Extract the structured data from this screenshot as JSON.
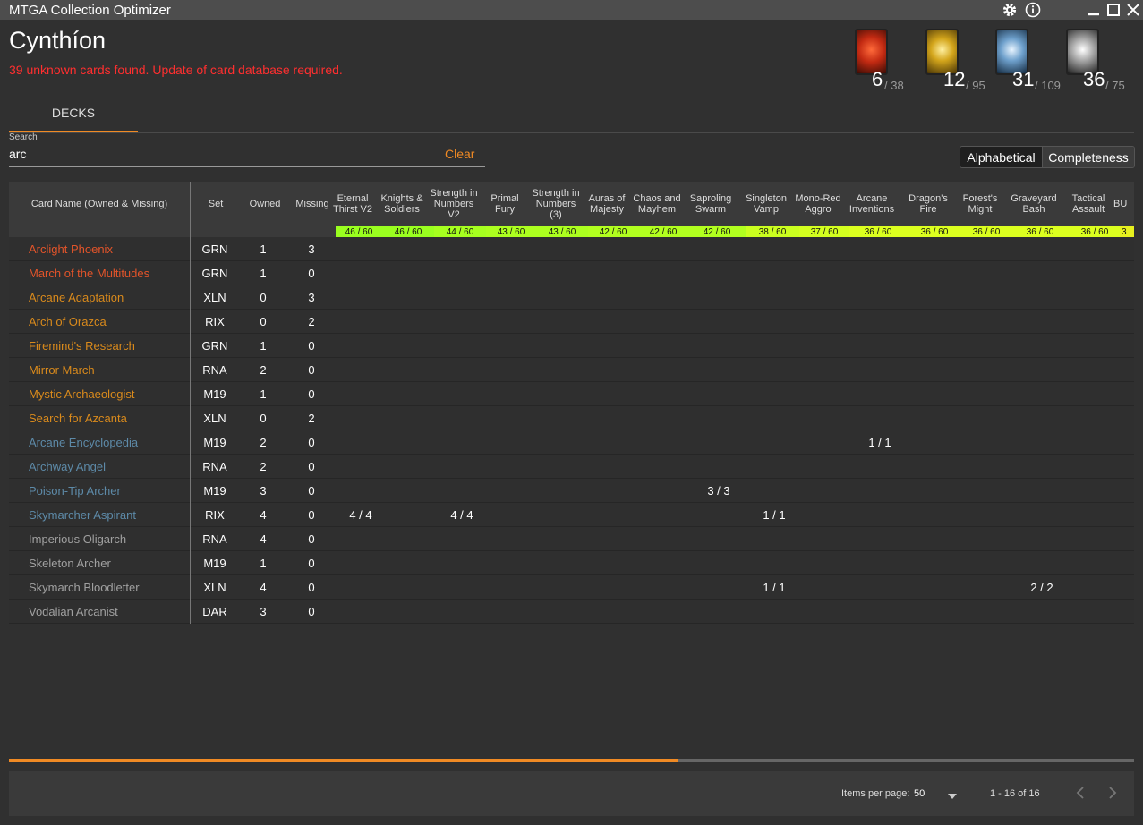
{
  "app": {
    "title": "MTGA Collection Optimizer"
  },
  "profile": {
    "name": "Cynthíon",
    "warning": "39 unknown cards found. Update of card database required."
  },
  "mana_counts": [
    {
      "icon": "red-mana-card-icon",
      "color": "#d23a1e",
      "owned": "6",
      "total": "/ 38"
    },
    {
      "icon": "gold-mana-card-icon",
      "color": "#c9a21a",
      "owned": "12",
      "total": "/ 95"
    },
    {
      "icon": "blue-mana-card-icon",
      "color": "#4f86b8",
      "owned": "31",
      "total": "/ 109"
    },
    {
      "icon": "black-mana-card-icon",
      "color": "#9a9a9a",
      "owned": "36",
      "total": "/ 75"
    }
  ],
  "tabs": {
    "decks": "DECKS"
  },
  "search": {
    "label": "Search",
    "value": "arc",
    "clear": "Clear"
  },
  "sort": {
    "alphabetical": "Alphabetical",
    "completeness": "Completeness"
  },
  "table": {
    "headers": {
      "card_name": "Card Name (Owned & Missing)",
      "set": "Set",
      "owned": "Owned",
      "missing": "Missing"
    },
    "decks": [
      {
        "name": "Eternal Thirst V2",
        "completion": "46 / 60",
        "color": "#9aff1f"
      },
      {
        "name": "Knights & Soldiers",
        "completion": "46 / 60",
        "color": "#9aff1f"
      },
      {
        "name": "Strength in Numbers V2",
        "completion": "44 / 60",
        "color": "#a6ff1f"
      },
      {
        "name": "Primal Fury",
        "completion": "43 / 60",
        "color": "#acff1f"
      },
      {
        "name": "Strength in Numbers (3)",
        "completion": "43 / 60",
        "color": "#acff1f"
      },
      {
        "name": "Auras of Majesty",
        "completion": "42 / 60",
        "color": "#b2ff1f"
      },
      {
        "name": "Chaos and Mayhem",
        "completion": "42 / 60",
        "color": "#b2ff1f"
      },
      {
        "name": "Saproling Swarm",
        "completion": "42 / 60",
        "color": "#b2ff1f"
      },
      {
        "name": "Singleton Vamp",
        "completion": "38 / 60",
        "color": "#cbff1f"
      },
      {
        "name": "Mono-Red Aggro",
        "completion": "37 / 60",
        "color": "#d4ff1f"
      },
      {
        "name": "Arcane Inventions",
        "completion": "36 / 60",
        "color": "#dcff1f"
      },
      {
        "name": "Dragon's Fire",
        "completion": "36 / 60",
        "color": "#dcff1f"
      },
      {
        "name": "Forest's Might",
        "completion": "36 / 60",
        "color": "#dcff1f"
      },
      {
        "name": "Graveyard Bash",
        "completion": "36 / 60",
        "color": "#dcff1f"
      },
      {
        "name": "Tactical Assault",
        "completion": "36 / 60",
        "color": "#dcff1f"
      },
      {
        "name": "BU",
        "completion": "3",
        "color": "#e6f01f"
      }
    ],
    "rows": [
      {
        "name": "Arclight Phoenix",
        "rarity_color": "#e2542a",
        "set": "GRN",
        "owned": "1",
        "missing": "3",
        "deck_values": [
          "",
          "",
          "",
          "",
          "",
          "",
          "",
          "",
          "",
          "",
          "",
          "",
          "",
          "",
          "",
          ""
        ]
      },
      {
        "name": "March of the Multitudes",
        "rarity_color": "#e2542a",
        "set": "GRN",
        "owned": "1",
        "missing": "0",
        "deck_values": [
          "",
          "",
          "",
          "",
          "",
          "",
          "",
          "",
          "",
          "",
          "",
          "",
          "",
          "",
          "",
          ""
        ]
      },
      {
        "name": "Arcane Adaptation",
        "rarity_color": "#d98a1c",
        "set": "XLN",
        "owned": "0",
        "missing": "3",
        "deck_values": [
          "",
          "",
          "",
          "",
          "",
          "",
          "",
          "",
          "",
          "",
          "",
          "",
          "",
          "",
          "",
          ""
        ]
      },
      {
        "name": "Arch of Orazca",
        "rarity_color": "#d98a1c",
        "set": "RIX",
        "owned": "0",
        "missing": "2",
        "deck_values": [
          "",
          "",
          "",
          "",
          "",
          "",
          "",
          "",
          "",
          "",
          "",
          "",
          "",
          "",
          "",
          ""
        ]
      },
      {
        "name": "Firemind's Research",
        "rarity_color": "#d98a1c",
        "set": "GRN",
        "owned": "1",
        "missing": "0",
        "deck_values": [
          "",
          "",
          "",
          "",
          "",
          "",
          "",
          "",
          "",
          "",
          "",
          "",
          "",
          "",
          "",
          ""
        ]
      },
      {
        "name": "Mirror March",
        "rarity_color": "#d98a1c",
        "set": "RNA",
        "owned": "2",
        "missing": "0",
        "deck_values": [
          "",
          "",
          "",
          "",
          "",
          "",
          "",
          "",
          "",
          "",
          "",
          "",
          "",
          "",
          "",
          ""
        ]
      },
      {
        "name": "Mystic Archaeologist",
        "rarity_color": "#d98a1c",
        "set": "M19",
        "owned": "1",
        "missing": "0",
        "deck_values": [
          "",
          "",
          "",
          "",
          "",
          "",
          "",
          "",
          "",
          "",
          "",
          "",
          "",
          "",
          "",
          ""
        ]
      },
      {
        "name": "Search for Azcanta",
        "rarity_color": "#d98a1c",
        "set": "XLN",
        "owned": "0",
        "missing": "2",
        "deck_values": [
          "",
          "",
          "",
          "",
          "",
          "",
          "",
          "",
          "",
          "",
          "",
          "",
          "",
          "",
          "",
          ""
        ]
      },
      {
        "name": "Arcane Encyclopedia",
        "rarity_color": "#5d8aa8",
        "set": "M19",
        "owned": "2",
        "missing": "0",
        "deck_values": [
          "",
          "",
          "",
          "",
          "",
          "",
          "",
          "",
          "",
          "",
          "1 / 1",
          "",
          "",
          "",
          "",
          ""
        ]
      },
      {
        "name": "Archway Angel",
        "rarity_color": "#5d8aa8",
        "set": "RNA",
        "owned": "2",
        "missing": "0",
        "deck_values": [
          "",
          "",
          "",
          "",
          "",
          "",
          "",
          "",
          "",
          "",
          "",
          "",
          "",
          "",
          "",
          ""
        ]
      },
      {
        "name": "Poison-Tip Archer",
        "rarity_color": "#5d8aa8",
        "set": "M19",
        "owned": "3",
        "missing": "0",
        "deck_values": [
          "",
          "",
          "",
          "",
          "",
          "",
          "",
          "3 / 3",
          "",
          "",
          "",
          "",
          "",
          "",
          "",
          ""
        ]
      },
      {
        "name": "Skymarcher Aspirant",
        "rarity_color": "#5d8aa8",
        "set": "RIX",
        "owned": "4",
        "missing": "0",
        "deck_values": [
          "4 / 4",
          "",
          "4 / 4",
          "",
          "",
          "",
          "",
          "",
          "1 / 1",
          "",
          "",
          "",
          "",
          "",
          "",
          ""
        ]
      },
      {
        "name": "Imperious Oligarch",
        "rarity_color": "#a0a0a0",
        "set": "RNA",
        "owned": "4",
        "missing": "0",
        "deck_values": [
          "",
          "",
          "",
          "",
          "",
          "",
          "",
          "",
          "",
          "",
          "",
          "",
          "",
          "",
          "",
          ""
        ]
      },
      {
        "name": "Skeleton Archer",
        "rarity_color": "#a0a0a0",
        "set": "M19",
        "owned": "1",
        "missing": "0",
        "deck_values": [
          "",
          "",
          "",
          "",
          "",
          "",
          "",
          "",
          "",
          "",
          "",
          "",
          "",
          "",
          "",
          ""
        ]
      },
      {
        "name": "Skymarch Bloodletter",
        "rarity_color": "#a0a0a0",
        "set": "XLN",
        "owned": "4",
        "missing": "0",
        "deck_values": [
          "",
          "",
          "",
          "",
          "",
          "",
          "",
          "",
          "1 / 1",
          "",
          "",
          "",
          "",
          "2 / 2",
          "",
          ""
        ]
      },
      {
        "name": "Vodalian Arcanist",
        "rarity_color": "#a0a0a0",
        "set": "DAR",
        "owned": "3",
        "missing": "0",
        "deck_values": [
          "",
          "",
          "",
          "",
          "",
          "",
          "",
          "",
          "",
          "",
          "",
          "",
          "",
          "",
          "",
          ""
        ]
      }
    ]
  },
  "scroll_progress": 0.595,
  "paginator": {
    "items_per_page_label": "Items per page:",
    "items_per_page": "50",
    "range": "1 - 16 of 16"
  },
  "colors": {
    "accent": "#f08a24",
    "warning": "#ff2f2f"
  }
}
